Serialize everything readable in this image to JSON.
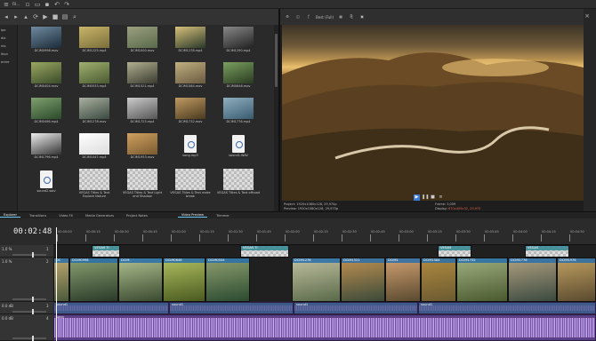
{
  "menubar": {
    "file_menu": "Fil...",
    "icons": [
      "new-icon",
      "open-icon",
      "save-icon",
      "undo-icon",
      "redo-icon"
    ]
  },
  "leftstrip": {
    "items": [
      "ipe",
      "dia",
      "nts",
      "",
      "ition",
      "entre",
      ""
    ]
  },
  "explorer": {
    "items": [
      {
        "name": "DCIM0998.mov",
        "kind": "video",
        "c1": "#1c2c3a",
        "c2": "#6f8aa0"
      },
      {
        "name": "DCIM1225.mp4",
        "kind": "video",
        "c1": "#7a6e3a",
        "c2": "#c9b56a"
      },
      {
        "name": "DCIM1000.mov",
        "kind": "video",
        "c1": "#5a6a4a",
        "c2": "#9aa080"
      },
      {
        "name": "DCIM1278.mp4",
        "kind": "video",
        "c1": "#2a3a2a",
        "c2": "#d7c07a"
      },
      {
        "name": "DCIM1290.mp4",
        "kind": "video",
        "c1": "#222",
        "c2": "#888"
      },
      {
        "name": "DCIM0404.mov",
        "kind": "video",
        "c1": "#3a4a2a",
        "c2": "#9aa860"
      },
      {
        "name": "DCIM0533.mp4",
        "kind": "video",
        "c1": "#4a5a30",
        "c2": "#a0b070"
      },
      {
        "name": "DCIM1521.mp4",
        "kind": "video",
        "c1": "#3a3a30",
        "c2": "#b0b090"
      },
      {
        "name": "DCIM1584.mov",
        "kind": "video",
        "c1": "#6a5a40",
        "c2": "#c0b080"
      },
      {
        "name": "DCIM0646.mov",
        "kind": "video",
        "c1": "#2a3a20",
        "c2": "#7aa060"
      },
      {
        "name": "DCIM0496.mp4",
        "kind": "video",
        "c1": "#2a4a2a",
        "c2": "#80a070"
      },
      {
        "name": "DCIM1278.mov",
        "kind": "video",
        "c1": "#3a4a40",
        "c2": "#aab0a0"
      },
      {
        "name": "DCIM1723.mp4",
        "kind": "video",
        "c1": "#555",
        "c2": "#ccc"
      },
      {
        "name": "DCIM1732.mov",
        "kind": "video",
        "c1": "#4a3a20",
        "c2": "#c09a60"
      },
      {
        "name": "DCIM1776.mp4",
        "kind": "video",
        "c1": "#3a5a70",
        "c2": "#90b0c0"
      },
      {
        "name": "DCIM1796.mp4",
        "kind": "video",
        "c1": "#333",
        "c2": "#eee"
      },
      {
        "name": "DCIM1047.mp4",
        "kind": "video",
        "c1": "#ddd",
        "c2": "#fff"
      },
      {
        "name": "DCIM1953.mov",
        "kind": "video",
        "c1": "#7a5a30",
        "c2": "#d0a060"
      },
      {
        "name": "song.mp3",
        "kind": "doc"
      },
      {
        "name": "sound1.WAV",
        "kind": "doc"
      },
      {
        "name": "sound2.wav",
        "kind": "doc"
      },
      {
        "name": "VEGAS Titles & Text Explore Nature",
        "kind": "check"
      },
      {
        "name": "VEGAS Titles & Text Light and Shadow",
        "kind": "check"
      },
      {
        "name": "VEGAS Titles & Text make break",
        "kind": "check"
      },
      {
        "name": "VEGAS Titles & Text offroad",
        "kind": "check"
      }
    ]
  },
  "preview": {
    "quality": "Best (Full)",
    "project_label": "Project:",
    "project_val": "1920x1080x128, 29,970p",
    "preview_label": "Preview:",
    "preview_val": "1920x1080x128, 29,970p",
    "frame_label": "Frame:",
    "frame_val": "3,059",
    "display_label": "Display:",
    "display_val": "670x405x32, 29,970"
  },
  "tabs": [
    "Explorer",
    "Transitions",
    "Video FX",
    "Media Generators",
    "Project Notes",
    "Video Preview",
    "Trimmer"
  ],
  "timeline": {
    "timecode": "00:02:48,29",
    "ruler": [
      "00:00:00",
      "00:00:15",
      "00:00:30",
      "00:00:45",
      "00:01:00",
      "00:01:15",
      "00:01:30",
      "00:01:45",
      "00:02:00",
      "00:02:15",
      "00:02:30",
      "00:02:45",
      "00:03:00",
      "00:03:15",
      "00:03:30",
      "00:03:45",
      "00:04:00",
      "00:04:15",
      "00:04:30"
    ],
    "tracks": [
      {
        "num": "1",
        "level": "1.0 %"
      },
      {
        "num": "2",
        "level": "1.0 %"
      },
      {
        "num": "3",
        "level": "0.0 dB"
      },
      {
        "num": "4",
        "level": "0.0 dB"
      }
    ],
    "video_clips_top": [
      {
        "label": "VEGAS Ti",
        "l": 43,
        "w": 32,
        "c": "#9a9a9a"
      },
      {
        "label": "VEGAS Ti",
        "l": 210,
        "w": 55,
        "c": "#9a9a9a"
      },
      {
        "label": "VEGAS",
        "l": 432,
        "w": 38,
        "c": "#9a9a9a"
      },
      {
        "label": "VEGAS",
        "l": 530,
        "w": 50,
        "c": "#9a9a9a"
      }
    ],
    "video_clips": [
      {
        "label": "DC",
        "l": 0,
        "w": 18,
        "c1": "#4a5a3a",
        "c2": "#c0a870"
      },
      {
        "label": "DCIM0998",
        "l": 18,
        "w": 55,
        "c1": "#2a3a2a",
        "c2": "#8aa070"
      },
      {
        "label": "DCIM",
        "l": 73,
        "w": 50,
        "c1": "#3a4a30",
        "c2": "#b0c090"
      },
      {
        "label": "DCIM0646",
        "l": 123,
        "w": 48,
        "c1": "#4a5a20",
        "c2": "#b0c060"
      },
      {
        "label": "DCIM0554",
        "l": 171,
        "w": 50,
        "c1": "#2a4a30",
        "c2": "#90a070"
      },
      {
        "label": "DCIM1278",
        "l": 268,
        "w": 55,
        "c1": "#5a6a4a",
        "c2": "#c0c0a0"
      },
      {
        "label": "DCIM1521",
        "l": 323,
        "w": 50,
        "c1": "#3a4a3a",
        "c2": "#c09050"
      },
      {
        "label": "DCIM1",
        "l": 373,
        "w": 40,
        "c1": "#5a4a30",
        "c2": "#d0a070"
      },
      {
        "label": "DCIM1584",
        "l": 413,
        "w": 40,
        "c1": "#6a5a30",
        "c2": "#b08a40"
      },
      {
        "label": "DCIM1732",
        "l": 453,
        "w": 58,
        "c1": "#4a5a30",
        "c2": "#a0b080"
      },
      {
        "label": "DCIM1776",
        "l": 511,
        "w": 55,
        "c1": "#3a4a40",
        "c2": "#b0a080"
      },
      {
        "label": "DCIM1976",
        "l": 566,
        "w": 44,
        "c1": "#5a4a30",
        "c2": "#c0a060"
      }
    ],
    "audio_top": [
      {
        "label": "sound1",
        "l": 0,
        "w": 130
      },
      {
        "label": "sound1",
        "l": 130,
        "w": 140
      },
      {
        "label": "sound1",
        "l": 270,
        "w": 140
      },
      {
        "label": "sound1",
        "l": 410,
        "w": 200
      }
    ],
    "audio_song": {
      "label": "song"
    }
  }
}
